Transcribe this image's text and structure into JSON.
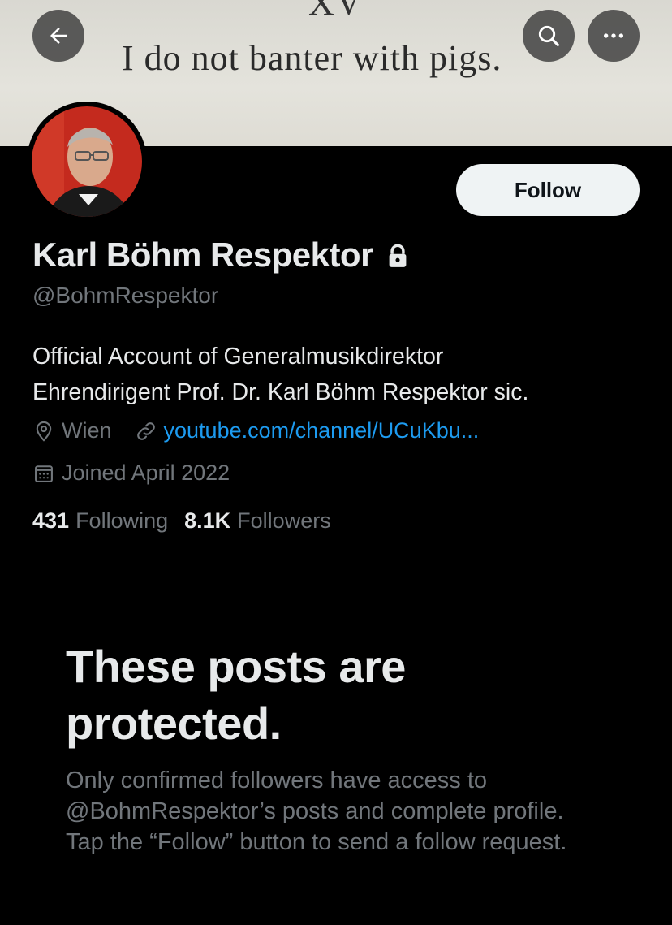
{
  "banner": {
    "roman": "XV",
    "quote": "I do not banter with pigs."
  },
  "header": {
    "back_icon": "arrow-left-icon",
    "search_icon": "search-icon",
    "more_icon": "more-horizontal-icon"
  },
  "profile": {
    "follow_label": "Follow",
    "name": "Karl Böhm Respektor",
    "lock_icon": "lock-icon",
    "handle": "@BohmRespektor",
    "bio_line1": "Official Account of Generalmusikdirektor",
    "bio_line2": "Ehrendirigent Prof. Dr. Karl Böhm Respektor sic.",
    "location": "Wien",
    "link": "youtube.com/channel/UCuKbu...",
    "joined": "Joined April 2022",
    "following_count": "431",
    "following_label": "Following",
    "followers_count": "8.1K",
    "followers_label": "Followers"
  },
  "protected": {
    "title": "These posts are protected.",
    "body": "Only confirmed followers have access to @BohmRespektor’s posts and complete profile. Tap the “Follow” button to send a follow request."
  },
  "colors": {
    "background": "#000000",
    "text": "#e7e9ea",
    "muted": "#71767b",
    "link": "#1d9bf0",
    "follow_bg": "#eff3f4"
  }
}
